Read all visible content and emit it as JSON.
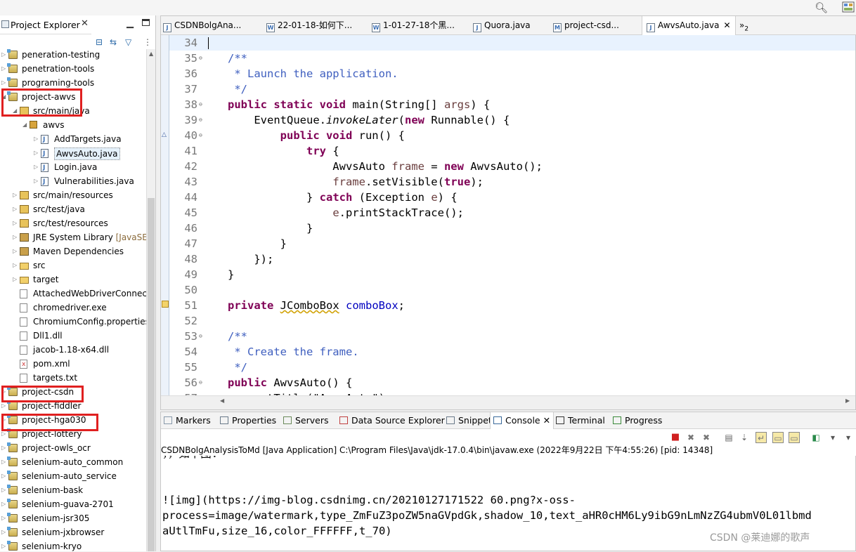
{
  "explorer": {
    "tab_label": "Project Explorer",
    "tree": [
      {
        "label": "peneration-testing",
        "indent": 0,
        "icon": "project",
        "arrow": "right"
      },
      {
        "label": "penetration-tools",
        "indent": 0,
        "icon": "project",
        "arrow": "right"
      },
      {
        "label": "programing-tools",
        "indent": 0,
        "icon": "project",
        "arrow": "right"
      },
      {
        "label": "project-awvs",
        "indent": 0,
        "icon": "project",
        "arrow": "down"
      },
      {
        "label": "src/main/java",
        "indent": 1,
        "icon": "package-folder",
        "arrow": "down"
      },
      {
        "label": "awvs",
        "indent": 2,
        "icon": "package",
        "arrow": "down"
      },
      {
        "label": "AddTargets.java",
        "indent": 3,
        "icon": "java",
        "arrow": "right"
      },
      {
        "label": "AwvsAuto.java",
        "indent": 3,
        "icon": "java",
        "arrow": "right",
        "selected": true
      },
      {
        "label": "Login.java",
        "indent": 3,
        "icon": "java",
        "arrow": "right"
      },
      {
        "label": "Vulnerabilities.java",
        "indent": 3,
        "icon": "java",
        "arrow": "right"
      },
      {
        "label": "src/main/resources",
        "indent": 1,
        "icon": "package-folder",
        "arrow": "right"
      },
      {
        "label": "src/test/java",
        "indent": 1,
        "icon": "package-folder",
        "arrow": "right"
      },
      {
        "label": "src/test/resources",
        "indent": 1,
        "icon": "package-folder",
        "arrow": "right"
      },
      {
        "label": "JRE System Library",
        "suffix": " [JavaSE-",
        "indent": 1,
        "icon": "library",
        "arrow": "right"
      },
      {
        "label": "Maven Dependencies",
        "indent": 1,
        "icon": "library",
        "arrow": "right"
      },
      {
        "label": "src",
        "indent": 1,
        "icon": "folder",
        "arrow": "right"
      },
      {
        "label": "target",
        "indent": 1,
        "icon": "folder",
        "arrow": "right"
      },
      {
        "label": "AttachedWebDriverConnect",
        "indent": 1,
        "icon": "file",
        "arrow": ""
      },
      {
        "label": "chromedriver.exe",
        "indent": 1,
        "icon": "file",
        "arrow": ""
      },
      {
        "label": "ChromiumConfig.properties",
        "indent": 1,
        "icon": "file",
        "arrow": ""
      },
      {
        "label": "Dll1.dll",
        "indent": 1,
        "icon": "file",
        "arrow": ""
      },
      {
        "label": "jacob-1.18-x64.dll",
        "indent": 1,
        "icon": "file",
        "arrow": ""
      },
      {
        "label": "pom.xml",
        "indent": 1,
        "icon": "xml",
        "arrow": ""
      },
      {
        "label": "targets.txt",
        "indent": 1,
        "icon": "file",
        "arrow": ""
      },
      {
        "label": "project-csdn",
        "indent": 0,
        "icon": "project",
        "arrow": "right"
      },
      {
        "label": "project-fiddler",
        "indent": 0,
        "icon": "project",
        "arrow": "right"
      },
      {
        "label": "project-hga030",
        "indent": 0,
        "icon": "project",
        "arrow": "right"
      },
      {
        "label": "project-lottery",
        "indent": 0,
        "icon": "project",
        "arrow": "right"
      },
      {
        "label": "project-owls_ocr",
        "indent": 0,
        "icon": "project",
        "arrow": "right"
      },
      {
        "label": "selenium-auto_common",
        "indent": 0,
        "icon": "project",
        "arrow": "right"
      },
      {
        "label": "selenium-auto_service",
        "indent": 0,
        "icon": "project",
        "arrow": "right"
      },
      {
        "label": "selenium-bask",
        "indent": 0,
        "icon": "project",
        "arrow": "right"
      },
      {
        "label": "selenium-guava-2701",
        "indent": 0,
        "icon": "project",
        "arrow": "right"
      },
      {
        "label": "selenium-jsr305",
        "indent": 0,
        "icon": "project",
        "arrow": "right"
      },
      {
        "label": "selenium-jxbrowser",
        "indent": 0,
        "icon": "project",
        "arrow": "right"
      },
      {
        "label": "selenium-kryo",
        "indent": 0,
        "icon": "project",
        "arrow": "right"
      }
    ]
  },
  "editor": {
    "tabs": [
      {
        "label": "CSDNBolgAna...",
        "icon": "J"
      },
      {
        "label": "22-01-18-如何下...",
        "icon": "W"
      },
      {
        "label": "1-01-27-18个黑...",
        "icon": "W"
      },
      {
        "label": "Quora.java",
        "icon": "J"
      },
      {
        "label": "project-csd...",
        "icon": "M"
      },
      {
        "label": "AwvsAuto.java",
        "icon": "J",
        "active": true
      }
    ],
    "overflow_label": "»",
    "overflow_count": "2",
    "lines": [
      {
        "n": "34",
        "fold": "",
        "html": ""
      },
      {
        "n": "35",
        "fold": "⊖",
        "html": "<span class=\"cm\">/**</span>"
      },
      {
        "n": "36",
        "fold": "",
        "html": "<span class=\"cm\"> * Launch the application.</span>"
      },
      {
        "n": "37",
        "fold": "",
        "html": "<span class=\"cm\"> */</span>"
      },
      {
        "n": "38",
        "fold": "⊖",
        "html": "<span class=\"kw\">public static void</span> main(String[] <span class=\"var\">args</span>) {"
      },
      {
        "n": "39",
        "fold": "⊖",
        "html": "    EventQueue.<span class=\"it\">invokeLater</span>(<span class=\"kw\">new</span> Runnable() {"
      },
      {
        "n": "40",
        "fold": "⊖",
        "html": "        <span class=\"kw\">public void</span> run() {"
      },
      {
        "n": "41",
        "fold": "",
        "html": "            <span class=\"kw\">try</span> {"
      },
      {
        "n": "42",
        "fold": "",
        "html": "                AwvsAuto <span class=\"var\">frame</span> = <span class=\"kw\">new</span> AwvsAuto();"
      },
      {
        "n": "43",
        "fold": "",
        "html": "                <span class=\"var\">frame</span>.setVisible(<span class=\"kw\">true</span>);"
      },
      {
        "n": "44",
        "fold": "",
        "html": "            } <span class=\"kw\">catch</span> (Exception <span class=\"var\">e</span>) {"
      },
      {
        "n": "45",
        "fold": "",
        "html": "                <span class=\"var\">e</span>.printStackTrace();"
      },
      {
        "n": "46",
        "fold": "",
        "html": "            }"
      },
      {
        "n": "47",
        "fold": "",
        "html": "        }"
      },
      {
        "n": "48",
        "fold": "",
        "html": "    });"
      },
      {
        "n": "49",
        "fold": "",
        "html": "}"
      },
      {
        "n": "50",
        "fold": "",
        "html": ""
      },
      {
        "n": "51",
        "fold": "",
        "html": "<span class=\"kw\">private</span> <span class=\"und\">JComboBox</span> <span class=\"fld\">comboBox</span>;"
      },
      {
        "n": "52",
        "fold": "",
        "html": ""
      },
      {
        "n": "53",
        "fold": "⊖",
        "html": "<span class=\"cm\">/**</span>"
      },
      {
        "n": "54",
        "fold": "",
        "html": "<span class=\"cm\"> * Create the frame.</span>"
      },
      {
        "n": "55",
        "fold": "",
        "html": "<span class=\"cm\"> */</span>"
      },
      {
        "n": "56",
        "fold": "⊖",
        "html": "<span class=\"kw\">public</span> AwvsAuto() {"
      },
      {
        "n": "57",
        "fold": "",
        "html": "    setTitle(\"AwvsAuto\");"
      }
    ]
  },
  "console": {
    "tabs": [
      {
        "label": "Markers"
      },
      {
        "label": "Properties"
      },
      {
        "label": "Servers"
      },
      {
        "label": "Data Source Explorer"
      },
      {
        "label": "Snippets"
      },
      {
        "label": "Console",
        "active": true,
        "close": "✕"
      },
      {
        "label": "Terminal"
      },
      {
        "label": "Progress"
      }
    ],
    "info": "CSDNBolgAnalysisToMd [Java Application] C:\\Program Files\\Java\\jdk-17.0.4\\bin\\javaw.exe  (2022年9月22日 下午4:55:26) [pid: 14348]",
    "output": [
      "，，如下图.",
      "",
      "",
      "![img](https://img-blog.csdnimg.cn/20210127171522 60.png?x-oss-",
      "process=image/watermark,type_ZmFuZ3poZW5naGVpdGk,shadow_10,text_aHR0cHM6Ly9ibG9nLmNzZG4ubmV0L01lbmd",
      "aUtlTmFu,size_16,color_FFFFFF,t_70)"
    ]
  },
  "watermark": "CSDN @莱迪娜的歌声",
  "colors": {
    "highlight_box": "#e02020",
    "keyword": "#7f0055",
    "comment": "#3f5fbf",
    "field": "#0000c0"
  }
}
